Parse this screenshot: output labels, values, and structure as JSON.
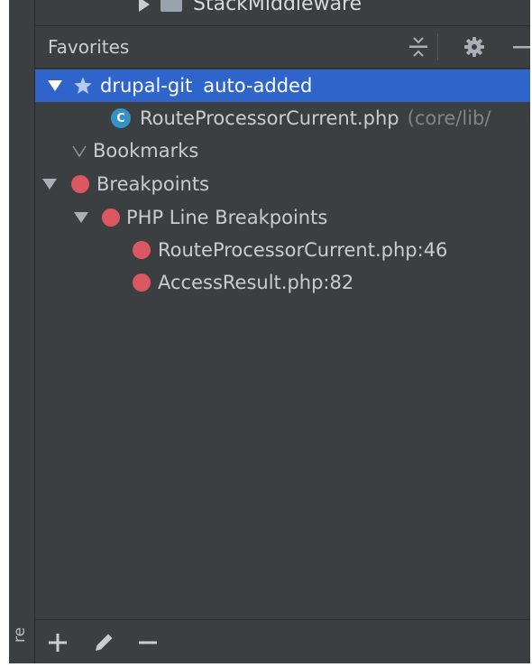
{
  "peek": {
    "label": "StackMiddleware"
  },
  "header": {
    "title": "Favorites"
  },
  "tree": {
    "favorite_list": {
      "name": "drupal-git",
      "suffix": "auto-added"
    },
    "favorite_file": {
      "name": "RouteProcessorCurrent.php",
      "path": "(core/lib/",
      "icon_letter": "C"
    },
    "bookmarks": {
      "label": "Bookmarks"
    },
    "breakpoints": {
      "label": "Breakpoints"
    },
    "php_line_breakpoints": {
      "label": "PHP Line Breakpoints"
    },
    "breakpoint_items": [
      {
        "label": "RouteProcessorCurrent.php:46"
      },
      {
        "label": "AccessResult.php:82"
      }
    ]
  },
  "side_stripe": {
    "label": "re"
  },
  "colors": {
    "panel_bg": "#3c3f41",
    "selection": "#2f65ca",
    "breakpoint_red": "#db5860",
    "class_icon_blue": "#3592c4"
  },
  "icons": {
    "header": [
      "collapse-all-icon",
      "gear-icon",
      "minimize-icon"
    ],
    "bottom": [
      "add-icon",
      "edit-pencil-icon",
      "remove-icon"
    ]
  }
}
